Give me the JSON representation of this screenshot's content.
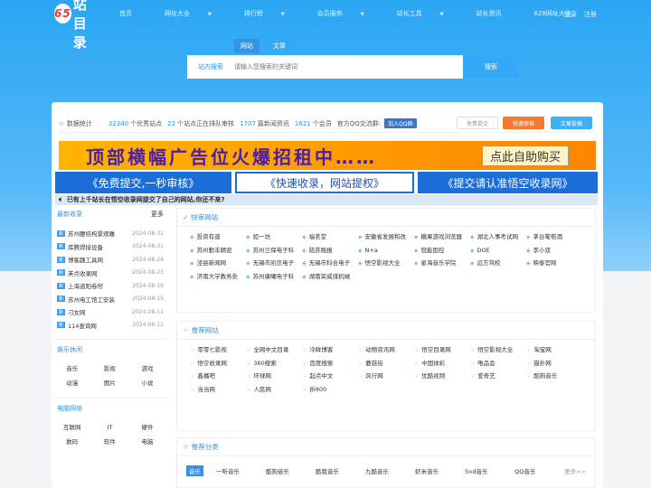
{
  "nav": {
    "logo_num": "65",
    "logo_text": "网站目录",
    "items": [
      "首页",
      "网址大全",
      "排行榜",
      "会员服务",
      "站长工具",
      "站长资讯",
      "628网址大全"
    ],
    "dropdowns": [
      false,
      true,
      true,
      true,
      true,
      false,
      false
    ],
    "login": "登录",
    "register": "注册"
  },
  "search": {
    "tab_site": "网站",
    "tab_article": "文章",
    "label": "站内搜索",
    "placeholder": "请输入您搜索的关键词",
    "button": "搜索"
  },
  "stats": {
    "label": "数据统计",
    "sites": "32340",
    "sites_suffix": "个优秀站点",
    "pending": "22",
    "pending_suffix": "个站点正在排队审核",
    "news": "1707",
    "news_suffix": "篇新闻资讯",
    "members": "1621",
    "members_suffix": "个会员",
    "qq_label": "官方QQ交流群:",
    "qq_button": "加入QQ群",
    "free_submit": "免费提交",
    "fast_review": "快速审核",
    "article_submit": "文章投稿"
  },
  "banner": {
    "text": "顶部横幅广告位火爆招租中……",
    "buy": "点此自助购买"
  },
  "bars": [
    "《免费提交,一秒审核》",
    "《快速收录，网站提权》",
    "《提交请认准悟空收录网》"
  ],
  "notice": "已有上千站长在悟空收录网提交了自己的网站,你还不来?",
  "sidebar": {
    "latest_title": "最新收录",
    "more": "更多",
    "tag": "新",
    "latest": [
      {
        "name": "苏州腰结构景观雕",
        "date": "2024-08-31"
      },
      {
        "name": "库腾焊接设备",
        "date": "2024-08-31"
      },
      {
        "name": "博客趣工具网",
        "date": "2024-08-24"
      },
      {
        "name": "芙点收录网",
        "date": "2024-08-23"
      },
      {
        "name": "上海道阳卷帘",
        "date": "2024-08-16"
      },
      {
        "name": "苏州电工馆工安装",
        "date": "2024-08-15"
      },
      {
        "name": "刁女网",
        "date": "2024-08-11"
      },
      {
        "name": "114查询网",
        "date": "2024-08-11"
      }
    ],
    "leisure_title": "娱乐休闲",
    "leisure": [
      "音乐",
      "影视",
      "游戏",
      "动漫",
      "图片",
      "小说"
    ],
    "computer_title": "电脑网络",
    "computer": [
      "互联网",
      "IT",
      "硬件",
      "数码",
      "软件",
      "电脑"
    ]
  },
  "fast": {
    "title": "快审网站",
    "items": [
      "投资有道",
      "如一坊",
      "福茗堂",
      "安徽省发展和改",
      "糖果游戏浏览器",
      "湖北人事考试网",
      "茅台葡萄酒",
      "苏州勤丰精密",
      "苏州兰保电子科",
      "陆苏晚报",
      "N+a",
      "冠能固控",
      "DOE",
      "李小双",
      "泾县新闻网",
      "无锡市凯信电子",
      "无锡市科合电子",
      "悟空影视大全",
      "星海音乐学院",
      "远方驾校",
      "映泰官网",
      "济南大学教务处",
      "苏州康曦电子科",
      "湖南荣威煤机械"
    ]
  },
  "recommend": {
    "title": "推荐网站",
    "items": [
      "零零七影视",
      "全网中文目录",
      "冷眸博客",
      "动物资讯网",
      "悟空目录网",
      "悟空影视大全",
      "淘宝网",
      "悟空收录网",
      "360搜索",
      "百度搜索",
      "蘑菇街",
      "中国体彩",
      "唯品会",
      "猫扑网",
      "鑫播吧",
      "环球网",
      "起点中文",
      "风行网",
      "优酷视频",
      "爱奇艺",
      "酷狗音乐",
      "当当网",
      "人民网",
      "折800"
    ]
  },
  "category": {
    "title": "推荐分类",
    "tag": "音乐",
    "items": [
      "一听音乐",
      "酷狗音乐",
      "酷我音乐",
      "九酷音乐",
      "虾米音乐",
      "5nd音乐",
      "QQ音乐"
    ],
    "more": "更多>>"
  }
}
